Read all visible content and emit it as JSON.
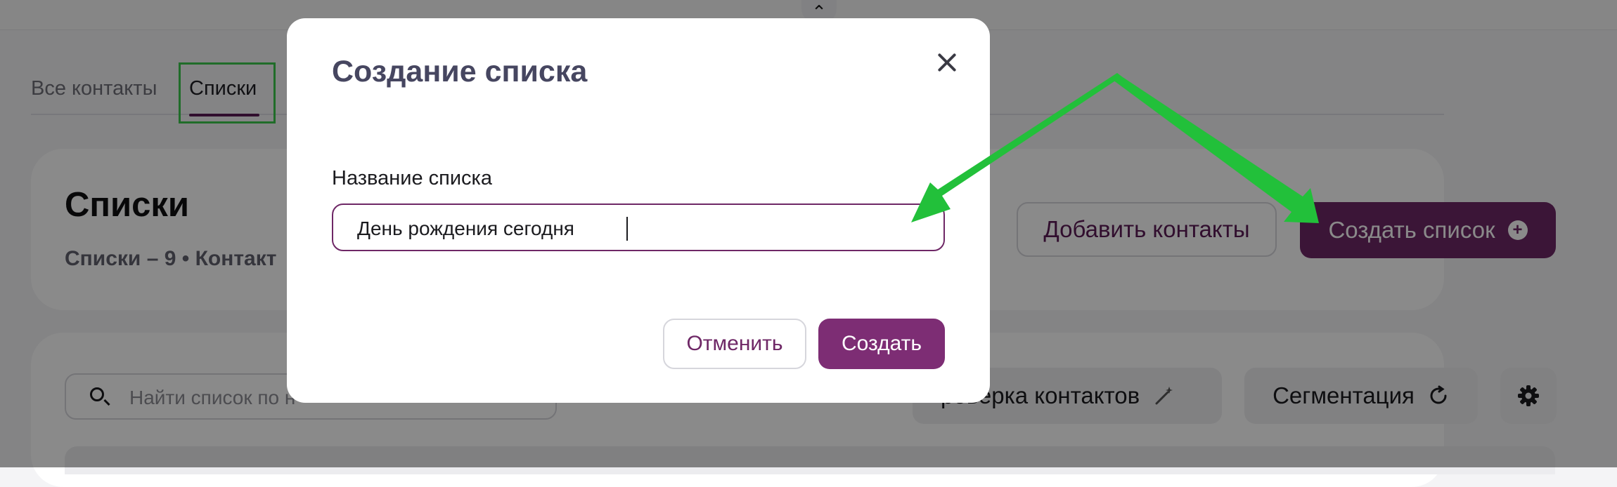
{
  "topbar": {
    "collapse_icon": "chevron-up-icon",
    "collapse_glyph": "⌃"
  },
  "tabs": [
    {
      "label": "Все контакты",
      "active": false
    },
    {
      "label": "Списки",
      "active": true
    }
  ],
  "lists_header": {
    "title": "Списки",
    "subtitle": "Списки – 9 • Контакт",
    "add_contacts_label": "Добавить контакты",
    "create_list_label": "Создать список",
    "create_list_icon": "plus-circle-icon"
  },
  "toolbar": {
    "search_placeholder": "Найти список по н",
    "check_contacts_label": "роверка контактов",
    "check_icon": "magic-wand-icon",
    "segmentation_label": "Сегментация",
    "segmentation_icon": "refresh-icon",
    "settings_icon": "gear-icon"
  },
  "modal": {
    "title": "Создание списка",
    "field_label": "Название списка",
    "field_value": "День рождения сегодня",
    "cancel_label": "Отменить",
    "submit_label": "Создать"
  },
  "colors": {
    "accent": "#6e2766",
    "highlight": "#3cc84d",
    "annotation_arrow": "#22c03a"
  }
}
